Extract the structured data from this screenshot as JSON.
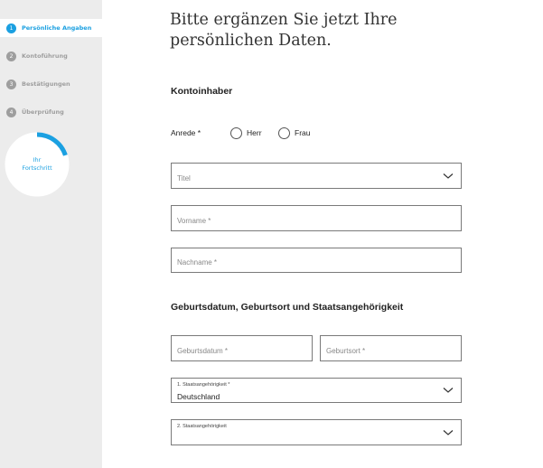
{
  "sidebar": {
    "steps": [
      {
        "num": "1",
        "label": "Persönliche Angaben"
      },
      {
        "num": "2",
        "label": "Kontoführung"
      },
      {
        "num": "3",
        "label": "Bestätigungen"
      },
      {
        "num": "4",
        "label": "Überprüfung"
      }
    ],
    "active_step": 1,
    "progress": {
      "line1": "Ihr",
      "line2": "Fortschritt",
      "fraction": 0.2
    },
    "accent_color": "#1ba0e1",
    "inactive_color": "#9e9e9e"
  },
  "form": {
    "title": "Bitte ergänzen Sie jetzt Ihre persönlichen Daten.",
    "section_kontoinhaber": "Kontoinhaber",
    "anrede_label": "Anrede *",
    "anrede_options": [
      "Herr",
      "Frau"
    ],
    "titel_placeholder": "Titel",
    "vorname_placeholder": "Vorname *",
    "nachname_placeholder": "Nachname *",
    "section_geburt": "Geburtsdatum, Geburtsort und Staatsangehörigkeit",
    "geburtsdatum_placeholder": "Geburtsdatum *",
    "geburtsort_placeholder": "Geburtsort *",
    "staat1_label": "1. Staatsangehörigkeit *",
    "staat1_value": "Deutschland",
    "staat2_label": "2. Staatsangehörigkeit"
  }
}
